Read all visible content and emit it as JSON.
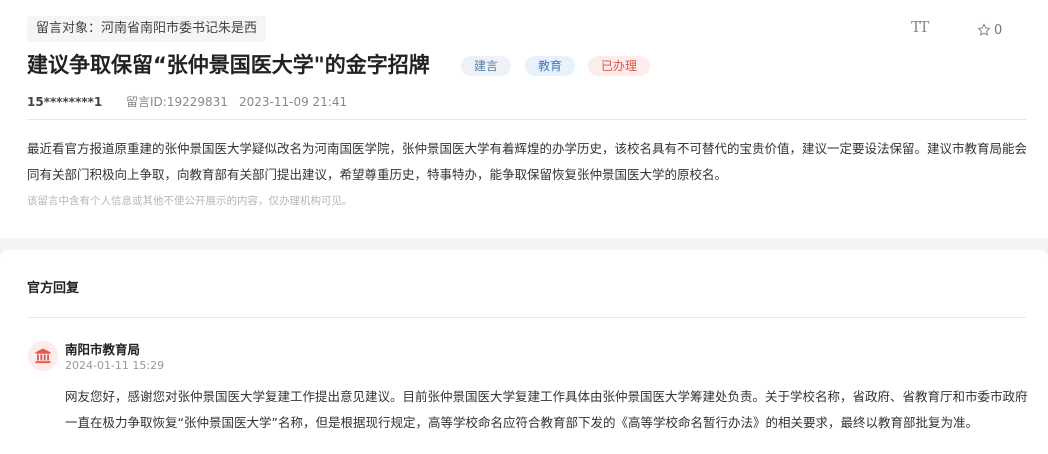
{
  "message": {
    "target": "留言对象：河南省南阳市委书记朱是西",
    "font_size_icon_label": "TT",
    "favorite_count": "0",
    "title": "建议争取保留“张仲景国医大学\"的金字招牌",
    "badges": [
      "建言",
      "教育",
      "已办理"
    ],
    "user": "15********1",
    "message_id": "留言ID:19229831",
    "date": "2023-11-09 21:41",
    "content": "最近看官方报道原重建的张仲景国医大学疑似改名为河南国医学院，张仲景国医大学有着辉煌的办学历史，该校名具有不可替代的宝贵价值，建议一定要设法保留。建议市教育局能会同有关部门积极向上争取，向教育部有关部门提出建议，希望尊重历史，特事特办，能争取保留恢复张仲景国医大学的原校名。",
    "privacy_note": "该留言中含有个人信息或其他不便公开展示的内容，仅办理机构可见。"
  },
  "reply": {
    "section_title": "官方回复",
    "org_name": "南阳市教育局",
    "date": "2024-01-11 15:29",
    "content": "网友您好，感谢您对张仲景国医大学复建工作提出意见建议。目前张仲景国医大学复建工作具体由张仲景国医大学筹建处负责。关于学校名称，省政府、省教育厅和市委市政府一直在极力争取恢复“张仲景国医大学”名称，但是根据现行规定，高等学校命名应符合教育部下发的《高等学校命名暂行办法》的相关要求，最终以教育部批复为准。"
  },
  "colors": {
    "badge_suggest": "#5a7ea6",
    "badge_edu": "#3d7cc0",
    "badge_done": "#d9534f",
    "avatar_icon": "#e05a4f"
  },
  "icons": [
    "font-size-icon",
    "star-icon",
    "government-building-icon"
  ]
}
